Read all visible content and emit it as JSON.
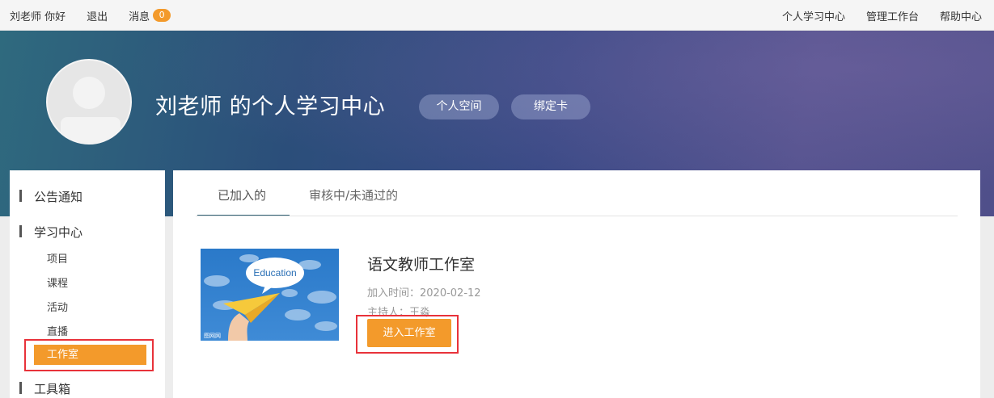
{
  "topbar": {
    "greeting": "刘老师 你好",
    "logout": "退出",
    "messages_label": "消息",
    "messages_count": "0",
    "links": [
      "个人学习中心",
      "管理工作台",
      "帮助中心"
    ]
  },
  "header": {
    "title": "刘老师 的个人学习中心",
    "personal_space": "个人空间",
    "bind_card": "绑定卡"
  },
  "sidebar": {
    "announcements": "公告通知",
    "learning_center": "学习中心",
    "items": [
      "项目",
      "课程",
      "活动",
      "直播"
    ],
    "active_item": "工作室",
    "toolbox": "工具箱"
  },
  "tabs": {
    "joined": "已加入的",
    "pending": "审核中/未通过的"
  },
  "studio": {
    "thumb_text": "Education",
    "thumb_watermark": "图网网",
    "name": "语文教师工作室",
    "join_time": "加入时间：2020-02-12",
    "host": "主持人：王淼",
    "enter_button": "进入工作室"
  },
  "colors": {
    "accent": "#f39a2b",
    "highlight_border": "#e8323a",
    "tab_underline": "#2f5f72"
  }
}
